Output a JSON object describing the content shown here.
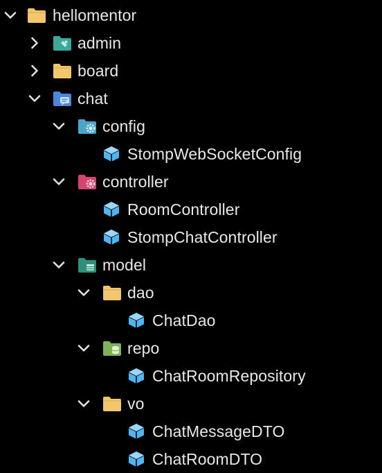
{
  "tree": {
    "nodes": [
      {
        "id": "hellomentor",
        "label": "hellomentor",
        "type": "folder",
        "expanded": true,
        "icon": "folder-icon"
      },
      {
        "id": "admin",
        "label": "admin",
        "type": "folder",
        "expanded": false,
        "icon": "folder-admin-icon"
      },
      {
        "id": "board",
        "label": "board",
        "type": "folder",
        "expanded": false,
        "icon": "folder-icon"
      },
      {
        "id": "chat",
        "label": "chat",
        "type": "folder",
        "expanded": true,
        "icon": "folder-chat-icon"
      },
      {
        "id": "config",
        "label": "config",
        "type": "folder",
        "expanded": true,
        "icon": "folder-config-icon"
      },
      {
        "id": "stomp-websocket-config",
        "label": "StompWebSocketConfig",
        "type": "class",
        "icon": "class-cube-icon"
      },
      {
        "id": "controller",
        "label": "controller",
        "type": "folder",
        "expanded": true,
        "icon": "folder-controller-icon"
      },
      {
        "id": "room-controller",
        "label": "RoomController",
        "type": "class",
        "icon": "class-cube-icon"
      },
      {
        "id": "stomp-chat-controller",
        "label": "StompChatController",
        "type": "class",
        "icon": "class-cube-icon"
      },
      {
        "id": "model",
        "label": "model",
        "type": "folder",
        "expanded": true,
        "icon": "folder-model-icon"
      },
      {
        "id": "dao",
        "label": "dao",
        "type": "folder",
        "expanded": true,
        "icon": "folder-icon"
      },
      {
        "id": "chat-dao",
        "label": "ChatDao",
        "type": "class",
        "icon": "class-cube-icon"
      },
      {
        "id": "repo",
        "label": "repo",
        "type": "folder",
        "expanded": true,
        "icon": "folder-repo-icon"
      },
      {
        "id": "chat-room-repository",
        "label": "ChatRoomRepository",
        "type": "class",
        "icon": "class-cube-icon"
      },
      {
        "id": "vo",
        "label": "vo",
        "type": "folder",
        "expanded": true,
        "icon": "folder-icon"
      },
      {
        "id": "chat-message-dto",
        "label": "ChatMessageDTO",
        "type": "class",
        "icon": "class-cube-icon"
      },
      {
        "id": "chat-room-dto",
        "label": "ChatRoomDTO",
        "type": "class",
        "icon": "class-cube-icon"
      }
    ]
  },
  "colors": {
    "background": "#000000",
    "text": "#e8e8e8",
    "chevron": "#e0e0e0",
    "folder": "#f3c66b",
    "folder_admin": "#3ea79b",
    "folder_chat": "#4a88dd",
    "folder_config": "#4aa6c8",
    "folder_controller": "#d2466e",
    "folder_model": "#2f8f7a",
    "folder_repo": "#7fb35a",
    "class_cube": "#4fb4f2"
  }
}
